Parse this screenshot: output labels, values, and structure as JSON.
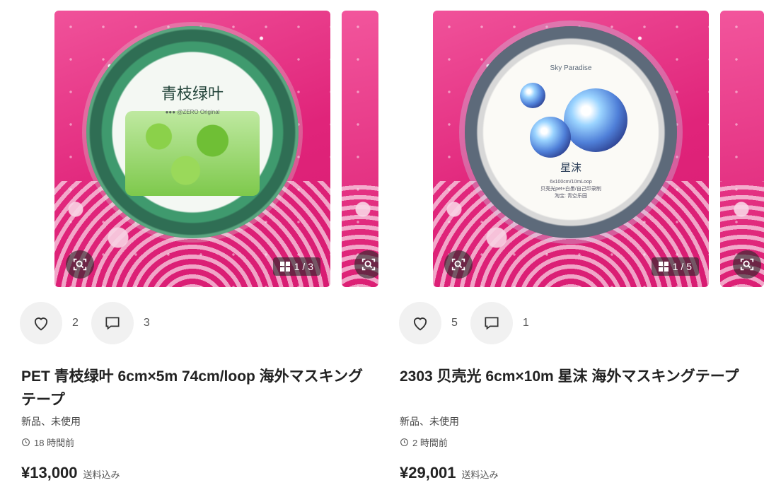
{
  "products": [
    {
      "title": "PET 青枝绿叶 6cm×5m 74cm/loop 海外マスキングテープ",
      "tape_label": "青枝绿叶",
      "tape_brand": "●●● @ZERO Original",
      "image_counter": "1 / 3",
      "likes": "2",
      "comments": "3",
      "condition": "新品、未使用",
      "time": "18 時間前",
      "price": "¥13,000",
      "shipping": "送料込み"
    },
    {
      "title": "2303 贝壳光 6cm×10m 星沫 海外マスキングテープ",
      "tape_label": "Sky Paradise",
      "tape_name": "星沫",
      "tape_spec": "6x100cm/10mLoop",
      "tape_spec2": "贝壳光pet+白墨/自己印录制",
      "tape_shop": "淘宝: 青空乐园",
      "image_counter": "1 / 5",
      "likes": "5",
      "comments": "1",
      "condition": "新品、未使用",
      "time": "2 時間前",
      "price": "¥29,001",
      "shipping": "送料込み"
    }
  ],
  "colors": {
    "background_pink": "#e0247a",
    "text_primary": "#222222",
    "button_bg": "#f1f1f1"
  },
  "icons": {
    "like": "heart-icon",
    "comment": "comment-icon",
    "scan": "image-search-icon",
    "gallery": "grid-icon",
    "time": "clock-icon"
  }
}
